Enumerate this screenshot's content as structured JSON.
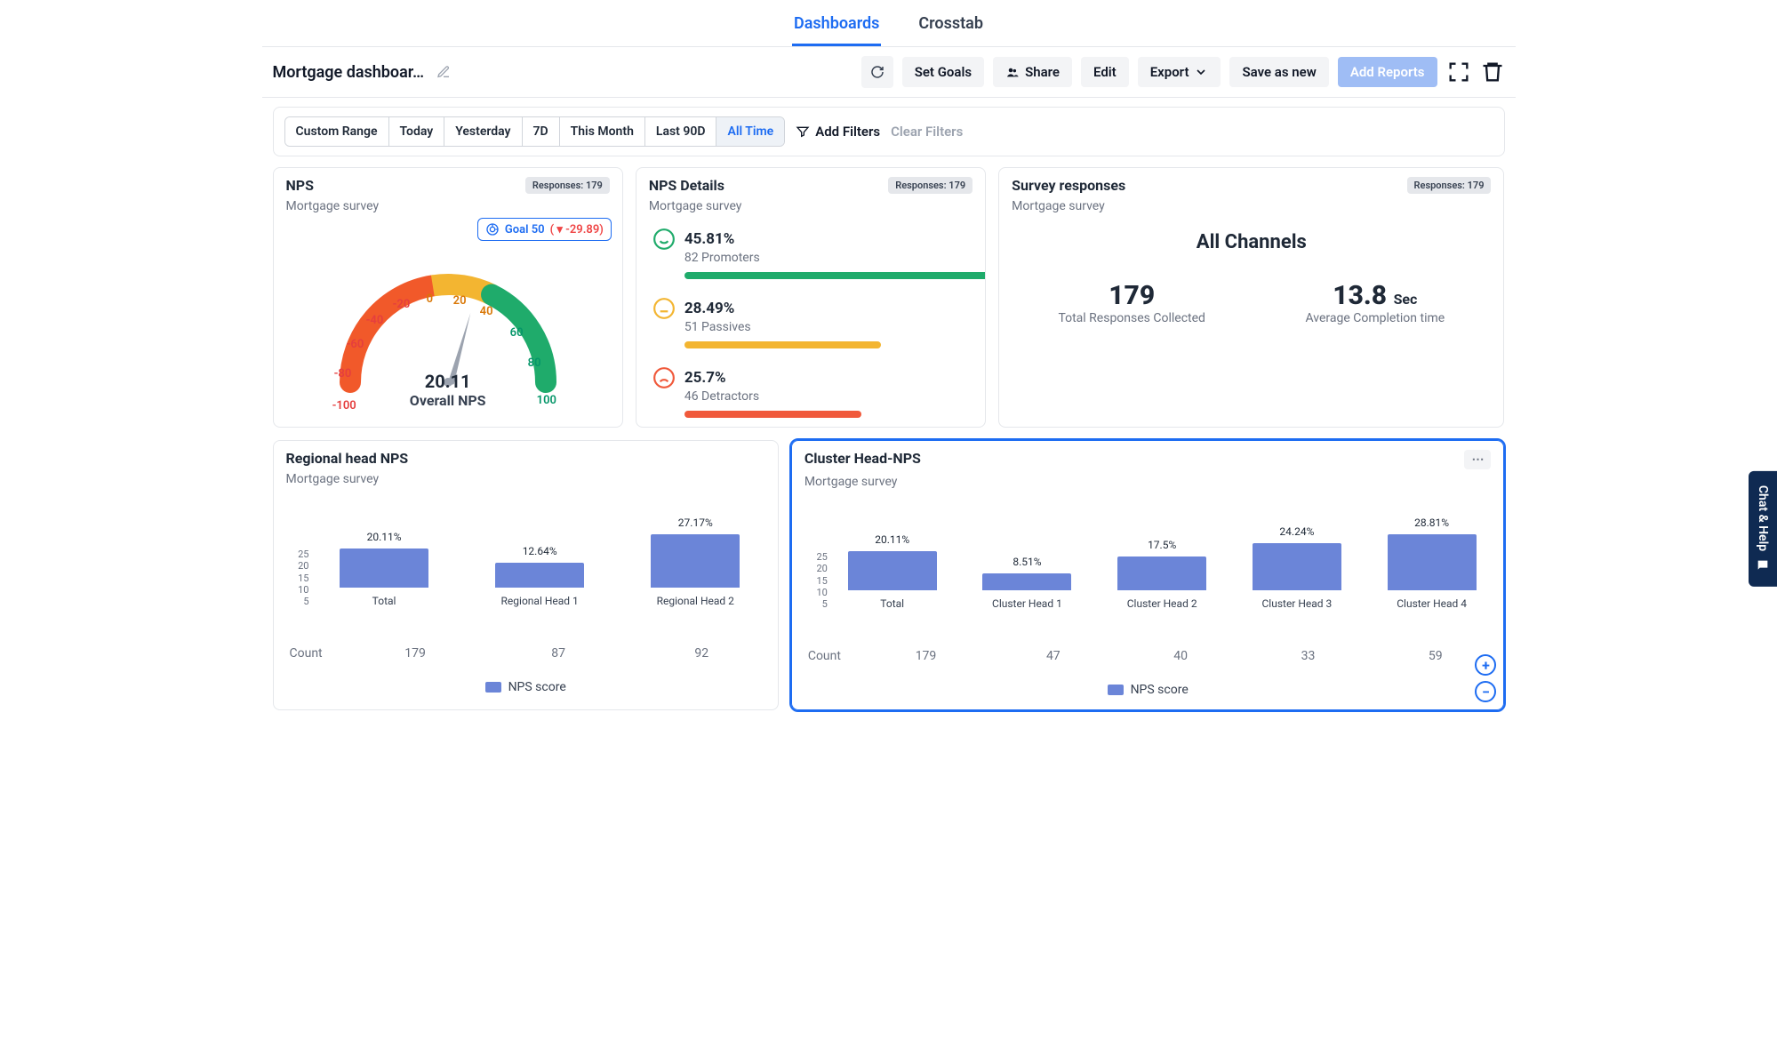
{
  "tabs": {
    "dashboards": "Dashboards",
    "crosstab": "Crosstab"
  },
  "header": {
    "title": "Mortgage dashboar…",
    "refresh": "",
    "set_goals": "Set Goals",
    "share": "Share",
    "edit": "Edit",
    "export": "Export",
    "save_as_new": "Save as new",
    "add_reports": "Add Reports"
  },
  "ranges": {
    "items": [
      "Custom Range",
      "Today",
      "Yesterday",
      "7D",
      "This Month",
      "Last 90D",
      "All Time"
    ],
    "active": "All Time",
    "add_filters": "Add Filters",
    "clear_filters": "Clear Filters"
  },
  "nps_card": {
    "title": "NPS",
    "subtitle": "Mortgage survey",
    "responses": "Responses: 179",
    "goal_label": "Goal 50",
    "goal_delta": "( ▾ -29.89)",
    "value": "20.11",
    "value_label": "Overall NPS",
    "ticks": {
      "n100": "-100",
      "n80": "-80",
      "n60": "-60",
      "n40": "-40",
      "n20": "-20",
      "z": "0",
      "p20": "20",
      "p40": "40",
      "p60": "60",
      "p80": "80",
      "p100": "100"
    }
  },
  "details_card": {
    "title": "NPS Details",
    "subtitle": "Mortgage survey",
    "responses": "Responses: 179",
    "promoters": {
      "pct": "45.81%",
      "sub": "82 Promoters",
      "color": "#1fab6b",
      "width": "100%"
    },
    "passives": {
      "pct": "28.49%",
      "sub": "51 Passives",
      "color": "#f3b531",
      "width": "62%"
    },
    "detractors": {
      "pct": "25.7%",
      "sub": "46 Detractors",
      "color": "#f0593b",
      "width": "56%"
    }
  },
  "survey_card": {
    "title": "Survey responses",
    "subtitle": "Mortgage survey",
    "responses": "Responses: 179",
    "all_channels": "All Channels",
    "total": {
      "value": "179",
      "label": "Total Responses Collected"
    },
    "avg": {
      "value": "13.8",
      "unit": "Sec",
      "label": "Average Completion time"
    }
  },
  "regional": {
    "title": "Regional head NPS",
    "subtitle": "Mortgage survey",
    "count_label": "Count",
    "legend": "NPS score"
  },
  "cluster": {
    "title": "Cluster Head-NPS",
    "subtitle": "Mortgage survey",
    "count_label": "Count",
    "legend": "NPS score"
  },
  "chat_help": "Chat & Help",
  "chart_data": [
    {
      "type": "gauge",
      "title": "NPS",
      "value": 20.11,
      "range": [
        -100,
        100
      ],
      "segments": [
        {
          "from": -100,
          "to": -10,
          "color": "#f1592a"
        },
        {
          "from": -10,
          "to": 30,
          "color": "#f3b531"
        },
        {
          "from": 30,
          "to": 100,
          "color": "#1fab6b"
        }
      ],
      "goal": 50,
      "delta": -29.89
    },
    {
      "type": "bar",
      "title": "Regional head NPS",
      "categories": [
        "Total",
        "Regional Head 1",
        "Regional Head 2"
      ],
      "values": [
        20.11,
        12.64,
        27.17
      ],
      "counts": [
        179,
        87,
        92
      ],
      "ylim": [
        0,
        30
      ],
      "ylabel": "NPS score"
    },
    {
      "type": "bar",
      "title": "Cluster Head-NPS",
      "categories": [
        "Total",
        "Cluster  Head 1",
        "Cluster  Head 2",
        "Cluster  Head 3",
        "Cluster  Head 4"
      ],
      "values": [
        20.11,
        8.51,
        17.5,
        24.24,
        28.81
      ],
      "counts": [
        179,
        47,
        40,
        33,
        59
      ],
      "ylim": [
        0,
        30
      ],
      "ylabel": "NPS score"
    }
  ]
}
